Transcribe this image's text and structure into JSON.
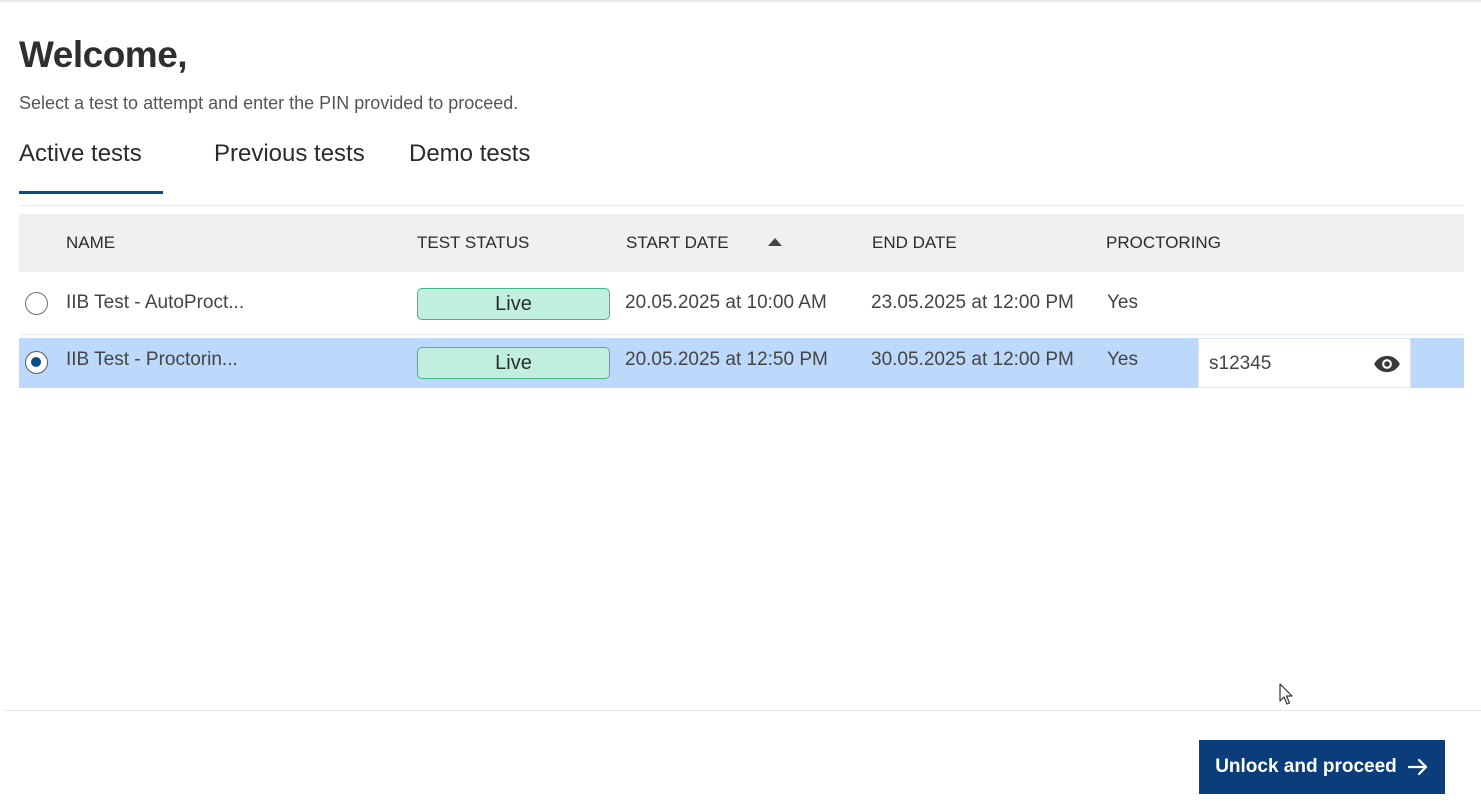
{
  "header": {
    "title": "Welcome,",
    "subtitle": "Select a test to attempt and enter the PIN provided to proceed."
  },
  "tabs": [
    {
      "label": "Active tests",
      "active": true
    },
    {
      "label": "Previous tests",
      "active": false
    },
    {
      "label": "Demo tests",
      "active": false
    }
  ],
  "table": {
    "columns": [
      "NAME",
      "TEST STATUS",
      "START DATE",
      "END DATE",
      "PROCTORING"
    ],
    "sort": {
      "column": "START DATE",
      "direction": "ascending"
    },
    "rows": [
      {
        "selected": false,
        "name": "IIB Test - AutoProct...",
        "status": "Live",
        "start": "20.05.2025 at 10:00 AM",
        "end": "23.05.2025 at 12:00 PM",
        "proctoring": "Yes"
      },
      {
        "selected": true,
        "name": "IIB Test - Proctorin...",
        "status": "Live",
        "start": "20.05.2025 at 12:50 PM",
        "end": "30.05.2025 at 12:00 PM",
        "proctoring": "Yes",
        "pin": "s12345"
      }
    ]
  },
  "footer": {
    "proceed_label": "Unlock and proceed"
  },
  "icons": {
    "sort": "sort-ascending-icon",
    "eye": "eye-icon",
    "arrow": "arrow-right-icon",
    "cursor": "mouse-pointer-icon"
  },
  "colors": {
    "accent": "#0b4a8b",
    "button": "#0b3d7a",
    "selected_row": "#bcd8fb",
    "live_badge_bg": "#c0f0dd",
    "live_badge_border": "#44b685",
    "header_bg": "#f0f0f0"
  }
}
